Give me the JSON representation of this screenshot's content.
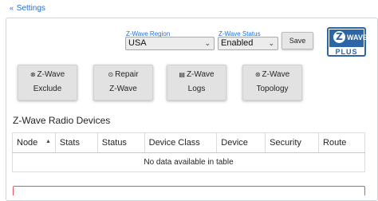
{
  "nav": {
    "back_label": "Settings"
  },
  "config": {
    "region_label": "Z-Wave Region",
    "region_value": "USA",
    "status_label": "Z-Wave Status",
    "status_value": "Enabled",
    "save_label": "Save"
  },
  "logo": {
    "brand": "Z-Wave",
    "z": "Z",
    "wave": "WAVE",
    "plus": "PLUS"
  },
  "actions": [
    {
      "line1": "Z-Wave",
      "line2": "Exclude",
      "icon": "exclude-icon"
    },
    {
      "line1": "Repair",
      "line2": "Z-Wave",
      "icon": "repair-icon"
    },
    {
      "line1": "Z-Wave",
      "line2": "Logs",
      "icon": "logs-icon"
    },
    {
      "line1": "Z-Wave",
      "line2": "Topology",
      "icon": "topology-icon"
    }
  ],
  "devices": {
    "title": "Z-Wave Radio Devices",
    "columns": [
      "Node",
      "Stats",
      "Status",
      "Device Class",
      "Device",
      "Security",
      "Route"
    ],
    "empty_message": "No data available in table"
  },
  "colors": {
    "accent": "#1e6fd9",
    "logo_blue": "#2d66a6",
    "alert_border": "#e05a5a"
  }
}
